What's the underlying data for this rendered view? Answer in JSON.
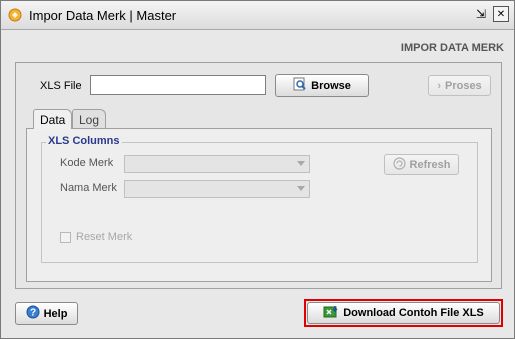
{
  "window": {
    "title": "Impor Data Merk | Master",
    "restore_glyph": "⇲",
    "close_glyph": "✕"
  },
  "header": {
    "label": "IMPOR DATA MERK"
  },
  "form": {
    "xls_file_label": "XLS File",
    "xls_file_value": "",
    "browse_label": "Browse",
    "proses_label": "Proses"
  },
  "tabs": [
    {
      "label": "Data",
      "active": true
    },
    {
      "label": "Log",
      "active": false
    }
  ],
  "xls_columns": {
    "title": "XLS Columns",
    "kode_merk_label": "Kode Merk",
    "kode_merk_value": "",
    "nama_merk_label": "Nama Merk",
    "nama_merk_value": "",
    "refresh_label": "Refresh",
    "reset_merk_label": "Reset Merk",
    "reset_merk_checked": false
  },
  "footer": {
    "help_label": "Help",
    "download_label": "Download Contoh File XLS"
  },
  "colors": {
    "highlight_border": "#e00000",
    "group_title": "#2a3a8c",
    "title_icon": "#e8a020"
  },
  "icons": {
    "title": "app-logo-icon",
    "browse": "magnifier-icon",
    "proses": "chevron-right-icon",
    "refresh": "refresh-icon",
    "help": "question-icon",
    "download": "excel-download-icon"
  }
}
